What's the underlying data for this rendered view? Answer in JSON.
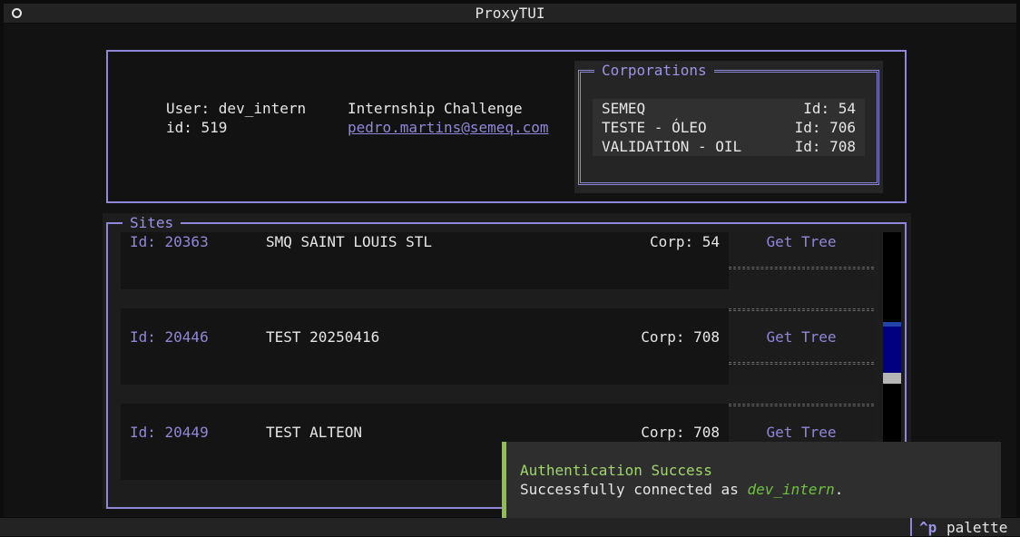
{
  "app": {
    "title": "ProxyTUI"
  },
  "user": {
    "label": "User: dev_intern",
    "id_label": "id: 519",
    "org": "Internship Challenge",
    "email": "pedro.martins@semeq.com"
  },
  "corporations": {
    "title": "Corporations",
    "rows": [
      {
        "name": "SEMEQ",
        "id": "Id: 54"
      },
      {
        "name": "TESTE - ÓLEO",
        "id": "Id: 706"
      },
      {
        "name": "VALIDATION - OIL",
        "id": "Id: 708"
      }
    ]
  },
  "sites": {
    "title": "Sites",
    "rows": [
      {
        "id": "Id: 20363",
        "name": "SMQ SAINT LOUIS STL",
        "corp": "Corp: 54",
        "button": "Get Tree"
      },
      {
        "id": "Id: 20446",
        "name": "TEST 20250416",
        "corp": "Corp: 708",
        "button": "Get Tree"
      },
      {
        "id": "Id: 20449",
        "name": "TEST ALTEON",
        "corp": "Corp: 708",
        "button": "Get Tree"
      }
    ]
  },
  "toast": {
    "title": "Authentication Success",
    "message_prefix": "Successfully connected as ",
    "username": "dev_intern",
    "message_suffix": "."
  },
  "footer": {
    "key": "^p",
    "label": "palette"
  },
  "colors": {
    "accent": "#8f87d7",
    "success": "#a2d66b",
    "scroll_thumb": "#000080"
  },
  "icons": {
    "app": "circle-icon"
  }
}
